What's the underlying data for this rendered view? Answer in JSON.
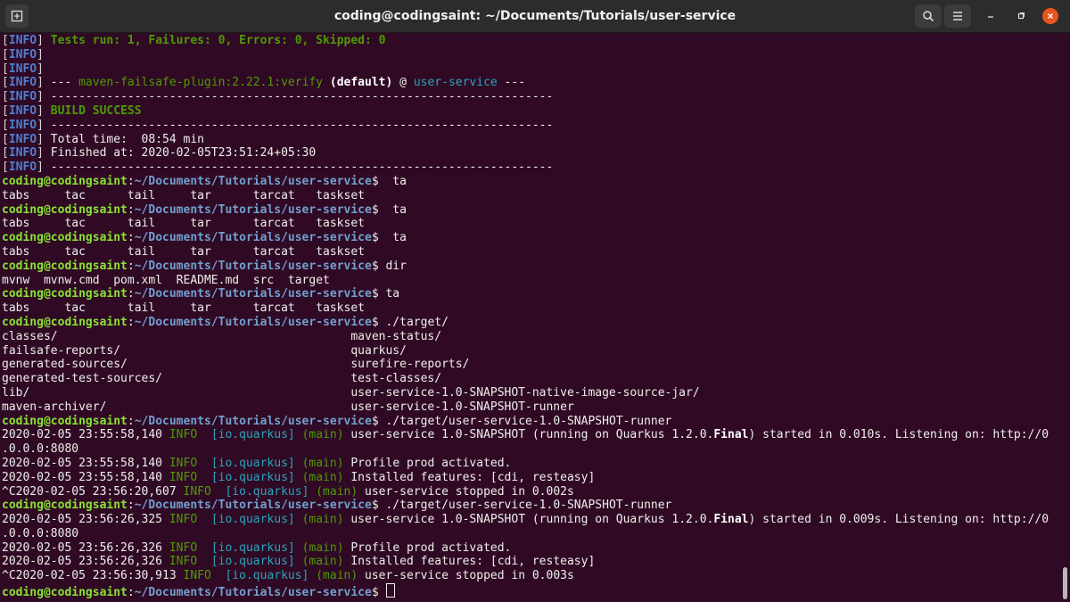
{
  "window": {
    "title": "coding@codingsaint: ~/Documents/Tutorials/user-service",
    "buttons": {
      "new_tab": "new-tab-icon",
      "search": "search-icon",
      "menu": "hamburger-menu-icon",
      "minimize": "minimize-icon",
      "maximize": "maximize-icon",
      "close": "close-icon"
    },
    "accent": "#e95420",
    "background": "#300a24"
  },
  "terminal": {
    "info_tag": "INFO",
    "tests_line": "Tests run: 1, Failures: 0, Errors: 0, Skipped: 0",
    "plugin_prefix": "--- ",
    "plugin_name": "maven-failsafe-plugin:2.22.1:verify",
    "plugin_default": "(default)",
    "plugin_at": " @ ",
    "plugin_project": "user-service",
    "plugin_suffix": " ---",
    "separator": "------------------------------------------------------------------------",
    "build_success": "BUILD SUCCESS",
    "total_time": "Total time:  08:54 min",
    "finished_at": "Finished at: 2020-02-05T23:51:24+05:30",
    "prompt_user": "coding@codingsaint",
    "prompt_path": "~/Documents/Tutorials/user-service",
    "prompt_sep": ":",
    "prompt_end": "$ ",
    "cmd_ta": " ta",
    "cmd_ta2": "ta",
    "cmd_dir": "dir",
    "cmd_target": "./target/",
    "cmd_runner": "./target/user-service-1.0-SNAPSHOT-runner",
    "completions": "tabs     tac      tail     tar      tarcat   taskset",
    "dir_output": "mvnw  mvnw.cmd  pom.xml  README.md  src  target",
    "target_listing": [
      "classes/                                          maven-status/",
      "failsafe-reports/                                 quarkus/",
      "generated-sources/                                surefire-reports/",
      "generated-test-sources/                           test-classes/",
      "lib/                                              user-service-1.0-SNAPSHOT-native-image-source-jar/",
      "maven-archiver/                                   user-service-1.0-SNAPSHOT-runner"
    ],
    "log_info": "INFO",
    "log_category": "[io.quarkus]",
    "log_thread": "(main)",
    "run1": {
      "ts1": "2020-02-05 23:55:58,140 ",
      "started_a": " user-service 1.0-SNAPSHOT (running on Quarkus 1.2.0.",
      "final": "Final",
      "started_b": ") started in 0.010s. Listening on: http://0",
      "wrap": ".0.0.0:8080",
      "ts2": "2020-02-05 23:55:58,140 ",
      "profile": " Profile prod activated.",
      "ts3": "2020-02-05 23:55:58,140 ",
      "features": " Installed features: [cdi, resteasy]",
      "ts4": "^C2020-02-05 23:56:20,607 ",
      "stopped": " user-service stopped in 0.002s"
    },
    "run2": {
      "ts1": "2020-02-05 23:56:26,325 ",
      "started_a": " user-service 1.0-SNAPSHOT (running on Quarkus 1.2.0.",
      "final": "Final",
      "started_b": ") started in 0.009s. Listening on: http://0",
      "wrap": ".0.0.0:8080",
      "ts2": "2020-02-05 23:56:26,326 ",
      "profile": " Profile prod activated.",
      "ts3": "2020-02-05 23:56:26,326 ",
      "features": " Installed features: [cdi, resteasy]",
      "ts4": "^C2020-02-05 23:56:30,913 ",
      "stopped": " user-service stopped in 0.003s"
    }
  }
}
